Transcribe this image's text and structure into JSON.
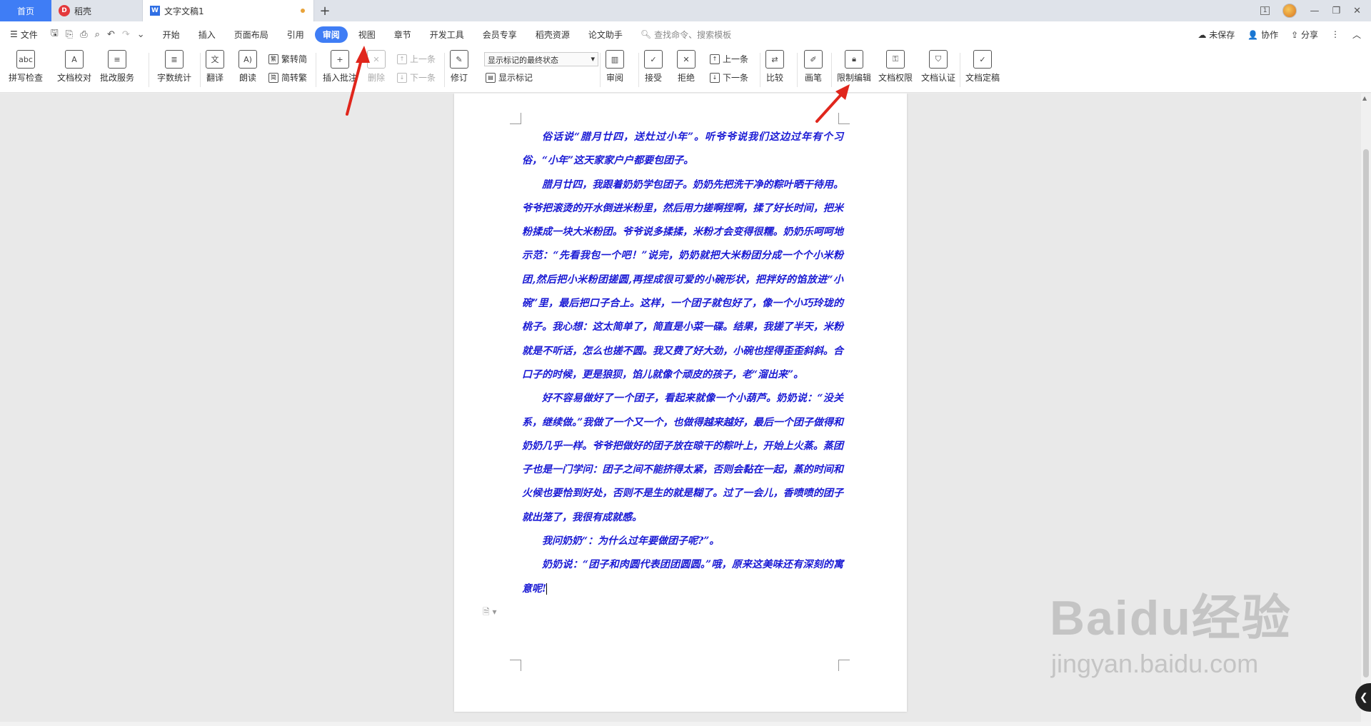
{
  "tabs": {
    "home": "首页",
    "docer": "稻壳",
    "document": "文字文稿1",
    "add": "+"
  },
  "window": {
    "page_indicator": "1",
    "min": "—",
    "restore": "❐",
    "close": "✕"
  },
  "menu": {
    "file": "文件",
    "items": [
      "开始",
      "插入",
      "页面布局",
      "引用",
      "审阅",
      "视图",
      "章节",
      "开发工具",
      "会员专享",
      "稻壳资源",
      "论文助手"
    ],
    "active": "审阅",
    "search": "查找命令、搜索模板",
    "right": {
      "unsaved": "未保存",
      "collaborate": "协作",
      "share": "分享"
    }
  },
  "ribbon": {
    "spell_check": "拼写检查",
    "doc_proof": "文档校对",
    "review_service": "批改服务",
    "word_count": "字数统计",
    "translate": "翻译",
    "read_aloud": "朗读",
    "trad_to_simp": "繁转简",
    "simp_to_trad": "简转繁",
    "insert_comment": "插入批注",
    "delete": "删除",
    "prev": "上一条",
    "next": "下一条",
    "revise": "修订",
    "markup_state": "显示标记的最终状态",
    "show_markup": "显示标记",
    "review_pane": "审阅",
    "accept": "接受",
    "reject": "拒绝",
    "prev2": "上一条",
    "next2": "下一条",
    "compare": "比较",
    "pen": "画笔",
    "restrict_edit": "限制编辑",
    "doc_permission": "文档权限",
    "doc_certify": "文档认证",
    "doc_finalize": "文档定稿"
  },
  "document": {
    "paragraphs": [
      "俗话说“腊月廿四，送灶过小年”。听爷爷说我们这边过年有个习俗，“小年”这天家家户户都要包团子。",
      "腊月廿四，我跟着奶奶学包团子。奶奶先把洗干净的粽叶晒干待用。爷爷把滚烫的开水倒进米粉里，然后用力搓啊捏啊，揉了好长时间，把米粉揉成一块大米粉团。爷爷说多揉揉，米粉才会变得很糯。奶奶乐呵呵地示范：“先看我包一个吧！”说完，奶奶就把大米粉团分成一个个小米粉团,然后把小米粉团搓圆,再捏成很可爱的小碗形状，把拌好的馅放进“小碗”里，最后把口子合上。这样，一个团子就包好了，像一个小巧玲珑的桃子。我心想：这太简单了，简直是小菜一碟。结果，我搓了半天，米粉就是不听话，怎么也搓不圆。我又费了好大劲，小碗也捏得歪歪斜斜。合口子的时候，更是狼狈，馅儿就像个顽皮的孩子，老“溜出来”。",
      "好不容易做好了一个团子，看起来就像一个小葫芦。奶奶说：“没关系，继续做。”我做了一个又一个，也做得越来越好，最后一个团子做得和奶奶几乎一样。爷爷把做好的团子放在晾干的粽叶上，开始上火蒸。蒸团子也是一门学问：团子之间不能挤得太紧，否则会黏在一起，蒸的时间和火候也要恰到好处，否则不是生的就是糊了。过了一会儿，香喷喷的团子就出笼了，我很有成就感。",
      "我问奶奶“：为什么过年要做团子呢?”。",
      "奶奶说：“团子和肉圆代表团团圆圆。”哦，原来这美味还有深刻的寓意呢!"
    ]
  },
  "watermark": {
    "brand": "Baidu经验",
    "url": "jingyan.baidu.com"
  },
  "colors": {
    "accent": "#3f7df5",
    "doc_text": "#1a1ad4",
    "arrow": "#e0261c"
  }
}
